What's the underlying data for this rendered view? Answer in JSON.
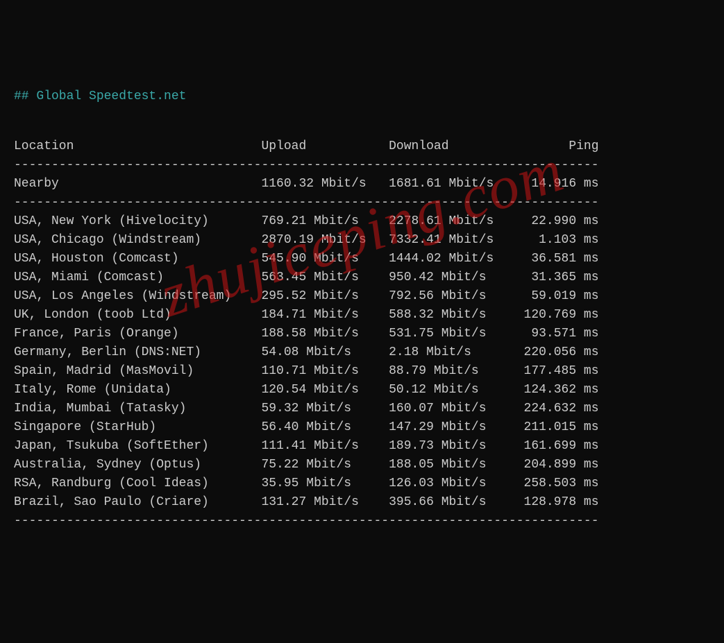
{
  "title": "## Global Speedtest.net",
  "watermark": "zhujiceping.com",
  "headers": {
    "location": "Location",
    "upload": "Upload",
    "download": "Download",
    "ping": "Ping"
  },
  "nearby": {
    "label": "Nearby",
    "upload": "1160.32 Mbit/s",
    "download": "1681.61 Mbit/s",
    "ping": "14.916 ms"
  },
  "rows": [
    {
      "location": "USA, New York (Hivelocity)",
      "upload": "769.21 Mbit/s",
      "download": "2278.61 Mbit/s",
      "ping": "22.990 ms"
    },
    {
      "location": "USA, Chicago (Windstream)",
      "upload": "2870.19 Mbit/s",
      "download": "7332.41 Mbit/s",
      "ping": "1.103 ms"
    },
    {
      "location": "USA, Houston (Comcast)",
      "upload": "545.90 Mbit/s",
      "download": "1444.02 Mbit/s",
      "ping": "36.581 ms"
    },
    {
      "location": "USA, Miami (Comcast)",
      "upload": "563.45 Mbit/s",
      "download": "950.42 Mbit/s",
      "ping": "31.365 ms"
    },
    {
      "location": "USA, Los Angeles (Windstream)",
      "upload": "295.52 Mbit/s",
      "download": "792.56 Mbit/s",
      "ping": "59.019 ms"
    },
    {
      "location": "UK, London (toob Ltd)",
      "upload": "184.71 Mbit/s",
      "download": "588.32 Mbit/s",
      "ping": "120.769 ms"
    },
    {
      "location": "France, Paris (Orange)",
      "upload": "188.58 Mbit/s",
      "download": "531.75 Mbit/s",
      "ping": "93.571 ms"
    },
    {
      "location": "Germany, Berlin (DNS:NET)",
      "upload": "54.08 Mbit/s",
      "download": "2.18 Mbit/s",
      "ping": "220.056 ms"
    },
    {
      "location": "Spain, Madrid (MasMovil)",
      "upload": "110.71 Mbit/s",
      "download": "88.79 Mbit/s",
      "ping": "177.485 ms"
    },
    {
      "location": "Italy, Rome (Unidata)",
      "upload": "120.54 Mbit/s",
      "download": "50.12 Mbit/s",
      "ping": "124.362 ms"
    },
    {
      "location": "India, Mumbai (Tatasky)",
      "upload": "59.32 Mbit/s",
      "download": "160.07 Mbit/s",
      "ping": "224.632 ms"
    },
    {
      "location": "Singapore (StarHub)",
      "upload": "56.40 Mbit/s",
      "download": "147.29 Mbit/s",
      "ping": "211.015 ms"
    },
    {
      "location": "Japan, Tsukuba (SoftEther)",
      "upload": "111.41 Mbit/s",
      "download": "189.73 Mbit/s",
      "ping": "161.699 ms"
    },
    {
      "location": "Australia, Sydney (Optus)",
      "upload": "75.22 Mbit/s",
      "download": "188.05 Mbit/s",
      "ping": "204.899 ms"
    },
    {
      "location": "RSA, Randburg (Cool Ideas)",
      "upload": "35.95 Mbit/s",
      "download": "126.03 Mbit/s",
      "ping": "258.503 ms"
    },
    {
      "location": "Brazil, Sao Paulo (Criare)",
      "upload": "131.27 Mbit/s",
      "download": "395.66 Mbit/s",
      "ping": "128.978 ms"
    }
  ],
  "chart_data": {
    "type": "table",
    "title": "Global Speedtest.net",
    "columns": [
      "Location",
      "Upload (Mbit/s)",
      "Download (Mbit/s)",
      "Ping (ms)"
    ],
    "rows": [
      [
        "Nearby",
        1160.32,
        1681.61,
        14.916
      ],
      [
        "USA, New York (Hivelocity)",
        769.21,
        2278.61,
        22.99
      ],
      [
        "USA, Chicago (Windstream)",
        2870.19,
        7332.41,
        1.103
      ],
      [
        "USA, Houston (Comcast)",
        545.9,
        1444.02,
        36.581
      ],
      [
        "USA, Miami (Comcast)",
        563.45,
        950.42,
        31.365
      ],
      [
        "USA, Los Angeles (Windstream)",
        295.52,
        792.56,
        59.019
      ],
      [
        "UK, London (toob Ltd)",
        184.71,
        588.32,
        120.769
      ],
      [
        "France, Paris (Orange)",
        188.58,
        531.75,
        93.571
      ],
      [
        "Germany, Berlin (DNS:NET)",
        54.08,
        2.18,
        220.056
      ],
      [
        "Spain, Madrid (MasMovil)",
        110.71,
        88.79,
        177.485
      ],
      [
        "Italy, Rome (Unidata)",
        120.54,
        50.12,
        124.362
      ],
      [
        "India, Mumbai (Tatasky)",
        59.32,
        160.07,
        224.632
      ],
      [
        "Singapore (StarHub)",
        56.4,
        147.29,
        211.015
      ],
      [
        "Japan, Tsukuba (SoftEther)",
        111.41,
        189.73,
        161.699
      ],
      [
        "Australia, Sydney (Optus)",
        75.22,
        188.05,
        204.899
      ],
      [
        "RSA, Randburg (Cool Ideas)",
        35.95,
        126.03,
        258.503
      ],
      [
        "Brazil, Sao Paulo (Criare)",
        131.27,
        395.66,
        128.978
      ]
    ]
  }
}
